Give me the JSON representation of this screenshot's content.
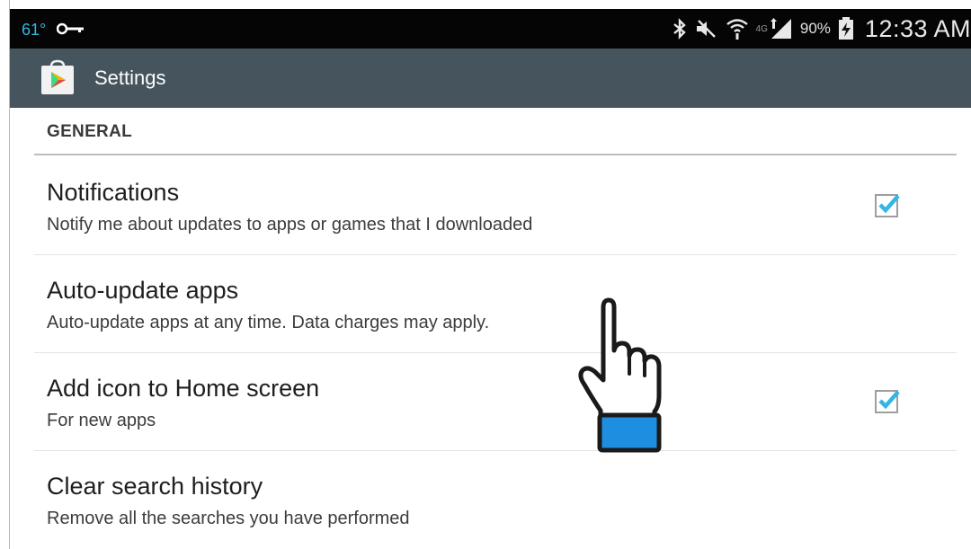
{
  "status_bar": {
    "temperature": "61°",
    "battery_percent": "90%",
    "time": "12:33 AM",
    "network_label": "4G",
    "icons": [
      "key-icon",
      "bluetooth-icon",
      "mute-icon",
      "wifi-icon",
      "signal-icon",
      "battery-charging-icon"
    ]
  },
  "action_bar": {
    "title": "Settings",
    "icon": "play-store-icon",
    "color": "#46555d"
  },
  "settings": {
    "section_title": "GENERAL",
    "items": [
      {
        "title": "Notifications",
        "summary": "Notify me about updates to apps or games that I downloaded",
        "checked": true
      },
      {
        "title": "Auto-update apps",
        "summary": "Auto-update apps at any time. Data charges may apply.",
        "checked": null
      },
      {
        "title": "Add icon to Home screen",
        "summary": "For new apps",
        "checked": true
      },
      {
        "title": "Clear search history",
        "summary": "Remove all the searches you have performed",
        "checked": null
      }
    ]
  },
  "colors": {
    "accent": "#33b5e5",
    "cursor_cuff": "#1e8fe0"
  }
}
